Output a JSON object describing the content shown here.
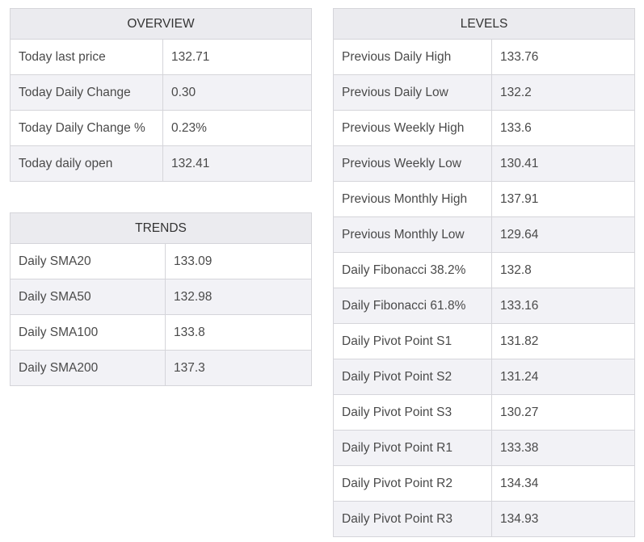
{
  "overview": {
    "title": "OVERVIEW",
    "rows": [
      {
        "label": "Today last price",
        "value": "132.71"
      },
      {
        "label": "Today Daily Change",
        "value": "0.30"
      },
      {
        "label": "Today Daily Change %",
        "value": "0.23%"
      },
      {
        "label": "Today daily open",
        "value": "132.41"
      }
    ]
  },
  "trends": {
    "title": "TRENDS",
    "rows": [
      {
        "label": "Daily SMA20",
        "value": "133.09"
      },
      {
        "label": "Daily SMA50",
        "value": "132.98"
      },
      {
        "label": "Daily SMA100",
        "value": "133.8"
      },
      {
        "label": "Daily SMA200",
        "value": "137.3"
      }
    ]
  },
  "levels": {
    "title": "LEVELS",
    "rows": [
      {
        "label": "Previous Daily High",
        "value": "133.76"
      },
      {
        "label": "Previous Daily Low",
        "value": "132.2"
      },
      {
        "label": "Previous Weekly High",
        "value": "133.6"
      },
      {
        "label": "Previous Weekly Low",
        "value": "130.41"
      },
      {
        "label": "Previous Monthly High",
        "value": "137.91"
      },
      {
        "label": "Previous Monthly Low",
        "value": "129.64"
      },
      {
        "label": "Daily Fibonacci 38.2%",
        "value": "132.8"
      },
      {
        "label": "Daily Fibonacci 61.8%",
        "value": "133.16"
      },
      {
        "label": "Daily Pivot Point S1",
        "value": "131.82"
      },
      {
        "label": "Daily Pivot Point S2",
        "value": "131.24"
      },
      {
        "label": "Daily Pivot Point S3",
        "value": "130.27"
      },
      {
        "label": "Daily Pivot Point R1",
        "value": "133.38"
      },
      {
        "label": "Daily Pivot Point R2",
        "value": "134.34"
      },
      {
        "label": "Daily Pivot Point R3",
        "value": "134.93"
      }
    ]
  }
}
